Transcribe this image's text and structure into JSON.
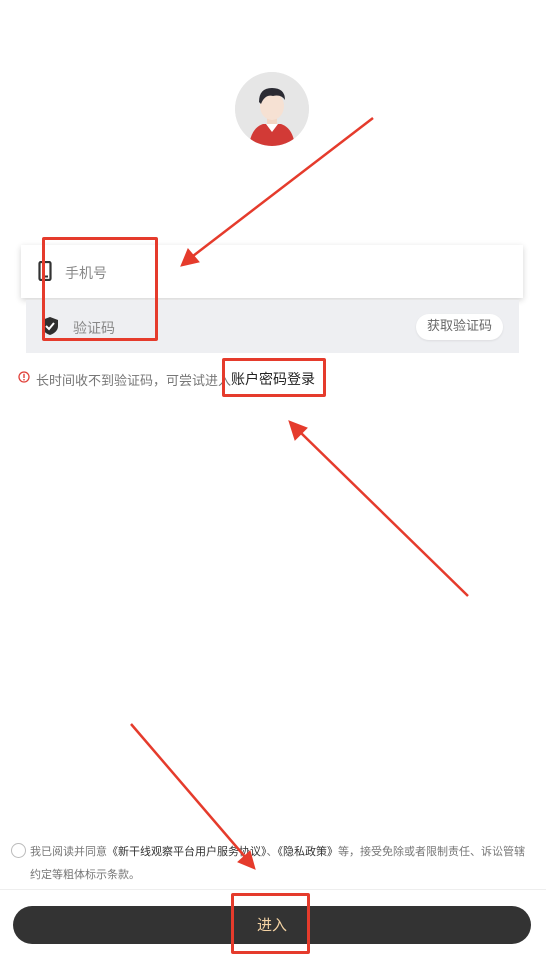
{
  "login": {
    "phone_placeholder": "手机号",
    "code_placeholder": "验证码",
    "get_code_label": "获取验证码"
  },
  "tip": {
    "text": "长时间收不到验证码，可尝试进入",
    "link": "账户密码登录"
  },
  "agreement": {
    "prefix": "我已阅读并同意",
    "doc1": "《新干线观察平台用户服务协议》",
    "sep": "、",
    "doc2": "《隐私政策》",
    "suffix": "等，接受免除或者限制责任、诉讼管辖约定等粗体标示条款。"
  },
  "submit": {
    "label": "进入"
  },
  "colors": {
    "button_bg": "#333333",
    "button_text": "#f4d3a4",
    "annotation_red": "#e53b2c",
    "code_row_bg": "#eeeff2"
  }
}
